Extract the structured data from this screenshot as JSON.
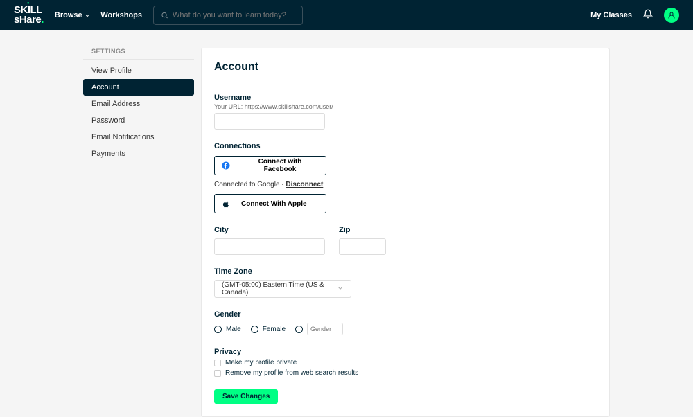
{
  "nav": {
    "logo_top": "SKILL",
    "logo_bottom": "sHare",
    "browse": "Browse",
    "workshops": "Workshops",
    "search_placeholder": "What do you want to learn today?",
    "my_classes": "My Classes"
  },
  "sidebar": {
    "title": "SETTINGS",
    "items": [
      "View Profile",
      "Account",
      "Email Address",
      "Password",
      "Email Notifications",
      "Payments"
    ]
  },
  "page": {
    "heading": "Account",
    "username_label": "Username",
    "url_hint": "Your URL: https://www.skillshare.com/user/",
    "connections_label": "Connections",
    "connect_facebook": "Connect with Facebook",
    "google_status": "Connected to Google ·",
    "disconnect": "Disconnect",
    "connect_apple": "Connect With Apple",
    "city_label": "City",
    "zip_label": "Zip",
    "timezone_label": "Time Zone",
    "timezone_value": "(GMT-05:00) Eastern Time (US & Canada)",
    "gender_label": "Gender",
    "gender_options": [
      "Male",
      "Female"
    ],
    "gender_placeholder": "Gender",
    "privacy_label": "Privacy",
    "privacy_options": [
      "Make my profile private",
      "Remove my profile from web search results"
    ],
    "save": "Save Changes"
  }
}
